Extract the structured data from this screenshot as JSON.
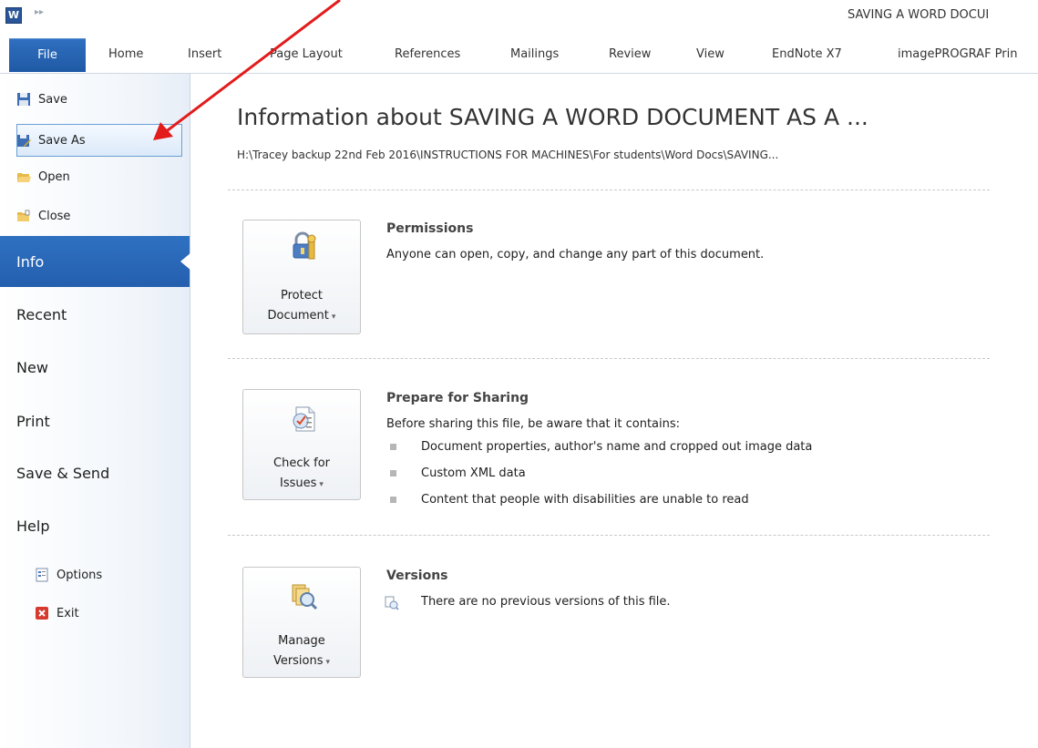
{
  "window": {
    "title": "SAVING A WORD DOCUI",
    "app_icon": "W",
    "qat_glyph": "▸▸"
  },
  "ribbon": {
    "file_tab": "File",
    "tabs": [
      "Home",
      "Insert",
      "Page Layout",
      "References",
      "Mailings",
      "Review",
      "View",
      "EndNote X7",
      "imagePROGRAF Prin"
    ]
  },
  "backstage": {
    "commands": [
      {
        "label": "Save",
        "icon": "save-icon"
      },
      {
        "label": "Save As",
        "icon": "save-as-icon"
      },
      {
        "label": "Open",
        "icon": "open-folder-icon"
      },
      {
        "label": "Close",
        "icon": "close-folder-icon"
      }
    ],
    "nav": [
      "Info",
      "Recent",
      "New",
      "Print",
      "Save & Send",
      "Help"
    ],
    "selected_nav": "Info",
    "footer_commands": [
      {
        "label": "Options",
        "icon": "options-icon"
      },
      {
        "label": "Exit",
        "icon": "exit-icon"
      }
    ]
  },
  "info": {
    "title": "Information about SAVING A WORD DOCUMENT AS A ...",
    "path": "H:\\Tracey backup 22nd Feb 2016\\INSTRUCTIONS FOR MACHINES\\For students\\Word Docs\\SAVING...",
    "sections": [
      {
        "button_line1": "Protect",
        "button_line2": "Document",
        "button_icon": "lock-key-icon",
        "heading": "Permissions",
        "text": "Anyone can open, copy, and change any part of this document."
      },
      {
        "button_line1": "Check for",
        "button_line2": "Issues",
        "button_icon": "checklist-icon",
        "heading": "Prepare for Sharing",
        "text": "Before sharing this file, be aware that it contains:",
        "bullets": [
          "Document properties, author's name and cropped out image data",
          "Custom XML data",
          "Content that people with disabilities are unable to read"
        ]
      },
      {
        "button_line1": "Manage",
        "button_line2": "Versions",
        "button_icon": "versions-icon",
        "heading": "Versions",
        "text": "There are no previous versions of this file."
      }
    ]
  },
  "colors": {
    "accent_blue": "#2a66b5",
    "annotation_red": "#e31b1b"
  }
}
